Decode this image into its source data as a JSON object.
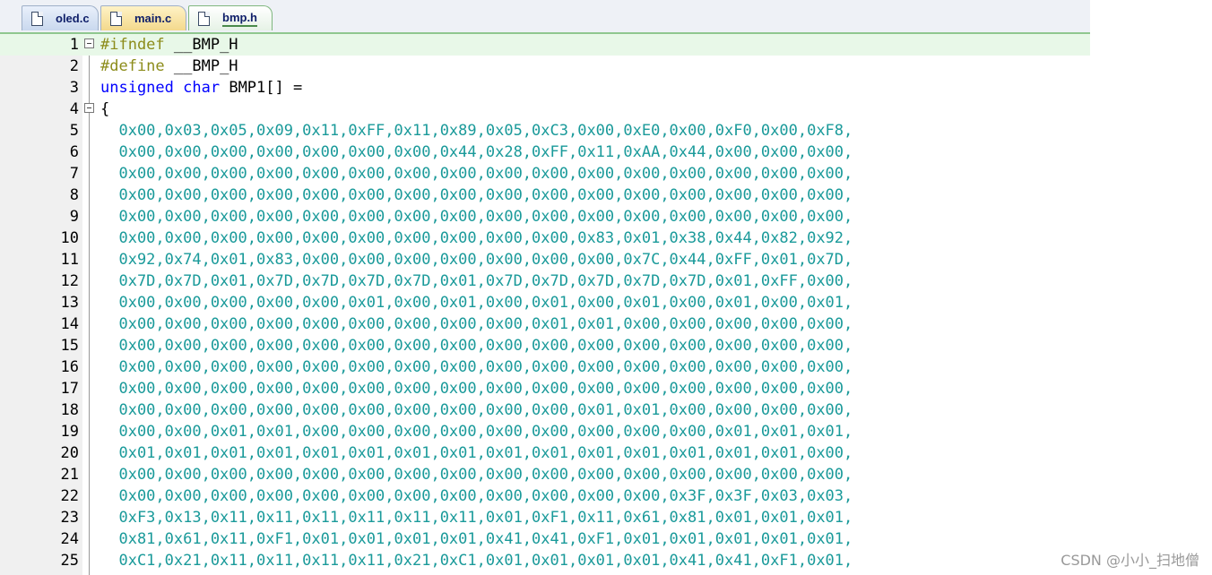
{
  "tabs": [
    {
      "label": "oled.c",
      "icon": "file-icon"
    },
    {
      "label": "main.c",
      "icon": "file-icon"
    },
    {
      "label": "bmp.h",
      "icon": "file-icon",
      "active": true
    }
  ],
  "lines": [
    {
      "num": "1",
      "parts": [
        {
          "t": "pre",
          "text": "#ifndef"
        },
        {
          "t": "plain",
          "text": " __BMP_H"
        }
      ],
      "fold": true,
      "current": true
    },
    {
      "num": "2",
      "parts": [
        {
          "t": "pre",
          "text": "#define"
        },
        {
          "t": "plain",
          "text": " __BMP_H"
        }
      ]
    },
    {
      "num": "3",
      "parts": [
        {
          "t": "kw",
          "text": "unsigned"
        },
        {
          "t": "plain",
          "text": " "
        },
        {
          "t": "kw",
          "text": "char"
        },
        {
          "t": "plain",
          "text": " BMP1[] ="
        }
      ]
    },
    {
      "num": "4",
      "parts": [
        {
          "t": "plain",
          "text": "{"
        }
      ],
      "fold": true
    },
    {
      "num": "5",
      "parts": [
        {
          "t": "hex",
          "text": "  0x00,0x03,0x05,0x09,0x11,0xFF,0x11,0x89,0x05,0xC3,0x00,0xE0,0x00,0xF0,0x00,0xF8,"
        }
      ]
    },
    {
      "num": "6",
      "parts": [
        {
          "t": "hex",
          "text": "  0x00,0x00,0x00,0x00,0x00,0x00,0x00,0x44,0x28,0xFF,0x11,0xAA,0x44,0x00,0x00,0x00,"
        }
      ]
    },
    {
      "num": "7",
      "parts": [
        {
          "t": "hex",
          "text": "  0x00,0x00,0x00,0x00,0x00,0x00,0x00,0x00,0x00,0x00,0x00,0x00,0x00,0x00,0x00,0x00,"
        }
      ]
    },
    {
      "num": "8",
      "parts": [
        {
          "t": "hex",
          "text": "  0x00,0x00,0x00,0x00,0x00,0x00,0x00,0x00,0x00,0x00,0x00,0x00,0x00,0x00,0x00,0x00,"
        }
      ]
    },
    {
      "num": "9",
      "parts": [
        {
          "t": "hex",
          "text": "  0x00,0x00,0x00,0x00,0x00,0x00,0x00,0x00,0x00,0x00,0x00,0x00,0x00,0x00,0x00,0x00,"
        }
      ]
    },
    {
      "num": "10",
      "parts": [
        {
          "t": "hex",
          "text": "  0x00,0x00,0x00,0x00,0x00,0x00,0x00,0x00,0x00,0x00,0x83,0x01,0x38,0x44,0x82,0x92,"
        }
      ]
    },
    {
      "num": "11",
      "parts": [
        {
          "t": "hex",
          "text": "  0x92,0x74,0x01,0x83,0x00,0x00,0x00,0x00,0x00,0x00,0x00,0x7C,0x44,0xFF,0x01,0x7D,"
        }
      ]
    },
    {
      "num": "12",
      "parts": [
        {
          "t": "hex",
          "text": "  0x7D,0x7D,0x01,0x7D,0x7D,0x7D,0x7D,0x01,0x7D,0x7D,0x7D,0x7D,0x7D,0x01,0xFF,0x00,"
        }
      ]
    },
    {
      "num": "13",
      "parts": [
        {
          "t": "hex",
          "text": "  0x00,0x00,0x00,0x00,0x00,0x01,0x00,0x01,0x00,0x01,0x00,0x01,0x00,0x01,0x00,0x01,"
        }
      ]
    },
    {
      "num": "14",
      "parts": [
        {
          "t": "hex",
          "text": "  0x00,0x00,0x00,0x00,0x00,0x00,0x00,0x00,0x00,0x01,0x01,0x00,0x00,0x00,0x00,0x00,"
        }
      ]
    },
    {
      "num": "15",
      "parts": [
        {
          "t": "hex",
          "text": "  0x00,0x00,0x00,0x00,0x00,0x00,0x00,0x00,0x00,0x00,0x00,0x00,0x00,0x00,0x00,0x00,"
        }
      ]
    },
    {
      "num": "16",
      "parts": [
        {
          "t": "hex",
          "text": "  0x00,0x00,0x00,0x00,0x00,0x00,0x00,0x00,0x00,0x00,0x00,0x00,0x00,0x00,0x00,0x00,"
        }
      ]
    },
    {
      "num": "17",
      "parts": [
        {
          "t": "hex",
          "text": "  0x00,0x00,0x00,0x00,0x00,0x00,0x00,0x00,0x00,0x00,0x00,0x00,0x00,0x00,0x00,0x00,"
        }
      ]
    },
    {
      "num": "18",
      "parts": [
        {
          "t": "hex",
          "text": "  0x00,0x00,0x00,0x00,0x00,0x00,0x00,0x00,0x00,0x00,0x01,0x01,0x00,0x00,0x00,0x00,"
        }
      ]
    },
    {
      "num": "19",
      "parts": [
        {
          "t": "hex",
          "text": "  0x00,0x00,0x01,0x01,0x00,0x00,0x00,0x00,0x00,0x00,0x00,0x00,0x00,0x01,0x01,0x01,"
        }
      ]
    },
    {
      "num": "20",
      "parts": [
        {
          "t": "hex",
          "text": "  0x01,0x01,0x01,0x01,0x01,0x01,0x01,0x01,0x01,0x01,0x01,0x01,0x01,0x01,0x01,0x00,"
        }
      ]
    },
    {
      "num": "21",
      "parts": [
        {
          "t": "hex",
          "text": "  0x00,0x00,0x00,0x00,0x00,0x00,0x00,0x00,0x00,0x00,0x00,0x00,0x00,0x00,0x00,0x00,"
        }
      ]
    },
    {
      "num": "22",
      "parts": [
        {
          "t": "hex",
          "text": "  0x00,0x00,0x00,0x00,0x00,0x00,0x00,0x00,0x00,0x00,0x00,0x00,0x3F,0x3F,0x03,0x03,"
        }
      ]
    },
    {
      "num": "23",
      "parts": [
        {
          "t": "hex",
          "text": "  0xF3,0x13,0x11,0x11,0x11,0x11,0x11,0x11,0x01,0xF1,0x11,0x61,0x81,0x01,0x01,0x01,"
        }
      ]
    },
    {
      "num": "24",
      "parts": [
        {
          "t": "hex",
          "text": "  0x81,0x61,0x11,0xF1,0x01,0x01,0x01,0x01,0x41,0x41,0xF1,0x01,0x01,0x01,0x01,0x01,"
        }
      ]
    },
    {
      "num": "25",
      "parts": [
        {
          "t": "hex",
          "text": "  0xC1,0x21,0x11,0x11,0x11,0x11,0x21,0xC1,0x01,0x01,0x01,0x01,0x41,0x41,0xF1,0x01,"
        }
      ]
    }
  ],
  "watermark": "CSDN @小小_扫地僧"
}
